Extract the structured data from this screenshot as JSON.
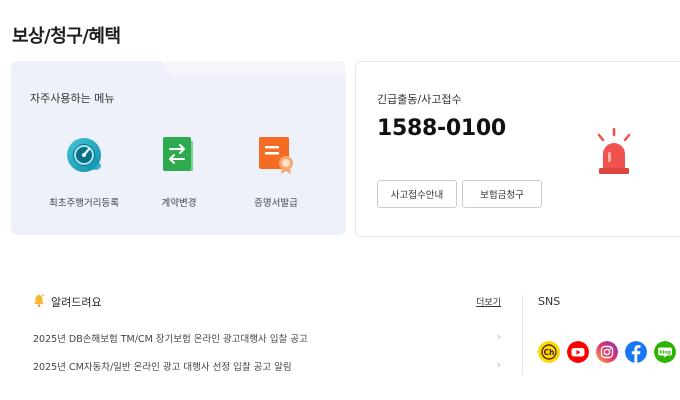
{
  "page": {
    "title": "보상/청구/혜택"
  },
  "menu": {
    "title": "자주사용하는 메뉴",
    "items": [
      {
        "label": "최초주행거리등록",
        "icon": "speedometer-icon",
        "color": "#1aa3b8"
      },
      {
        "label": "계약변경",
        "icon": "swap-document-icon",
        "color": "#2eaa4f"
      },
      {
        "label": "증명서발급",
        "icon": "certificate-icon",
        "color": "#f36c21"
      }
    ]
  },
  "emergency": {
    "label": "긴급출동/사고접수",
    "phone": "1588-0100",
    "buttons": {
      "accident": "사고접수안내",
      "claim": "보험금청구"
    },
    "icon": "siren-icon",
    "color": "#f0524f"
  },
  "notice": {
    "title": "알려드려요",
    "more": "더보기",
    "items": [
      "2025년 DB손해보험 TM/CM 장기보험 온라인 광고대행사 입찰 공고",
      "2025년 CM자동차/일반 온라인 광고 대행사 선정 입찰 공고 알림"
    ]
  },
  "sns": {
    "title": "SNS",
    "icons": [
      {
        "name": "kakao-channel-icon",
        "glyph": "Ch",
        "bg": "#ffd800",
        "fg": "#3a1d1d"
      },
      {
        "name": "youtube-icon",
        "glyph": "▶",
        "bg": "#ff0000",
        "fg": "#ffffff"
      },
      {
        "name": "instagram-icon",
        "glyph": "◎",
        "bg": "#d6249f",
        "fg": "#ffffff"
      },
      {
        "name": "facebook-icon",
        "glyph": "f",
        "bg": "#1877f2",
        "fg": "#ffffff"
      },
      {
        "name": "blog-icon",
        "glyph": "blog",
        "bg": "#2db400",
        "fg": "#ffffff"
      }
    ]
  }
}
